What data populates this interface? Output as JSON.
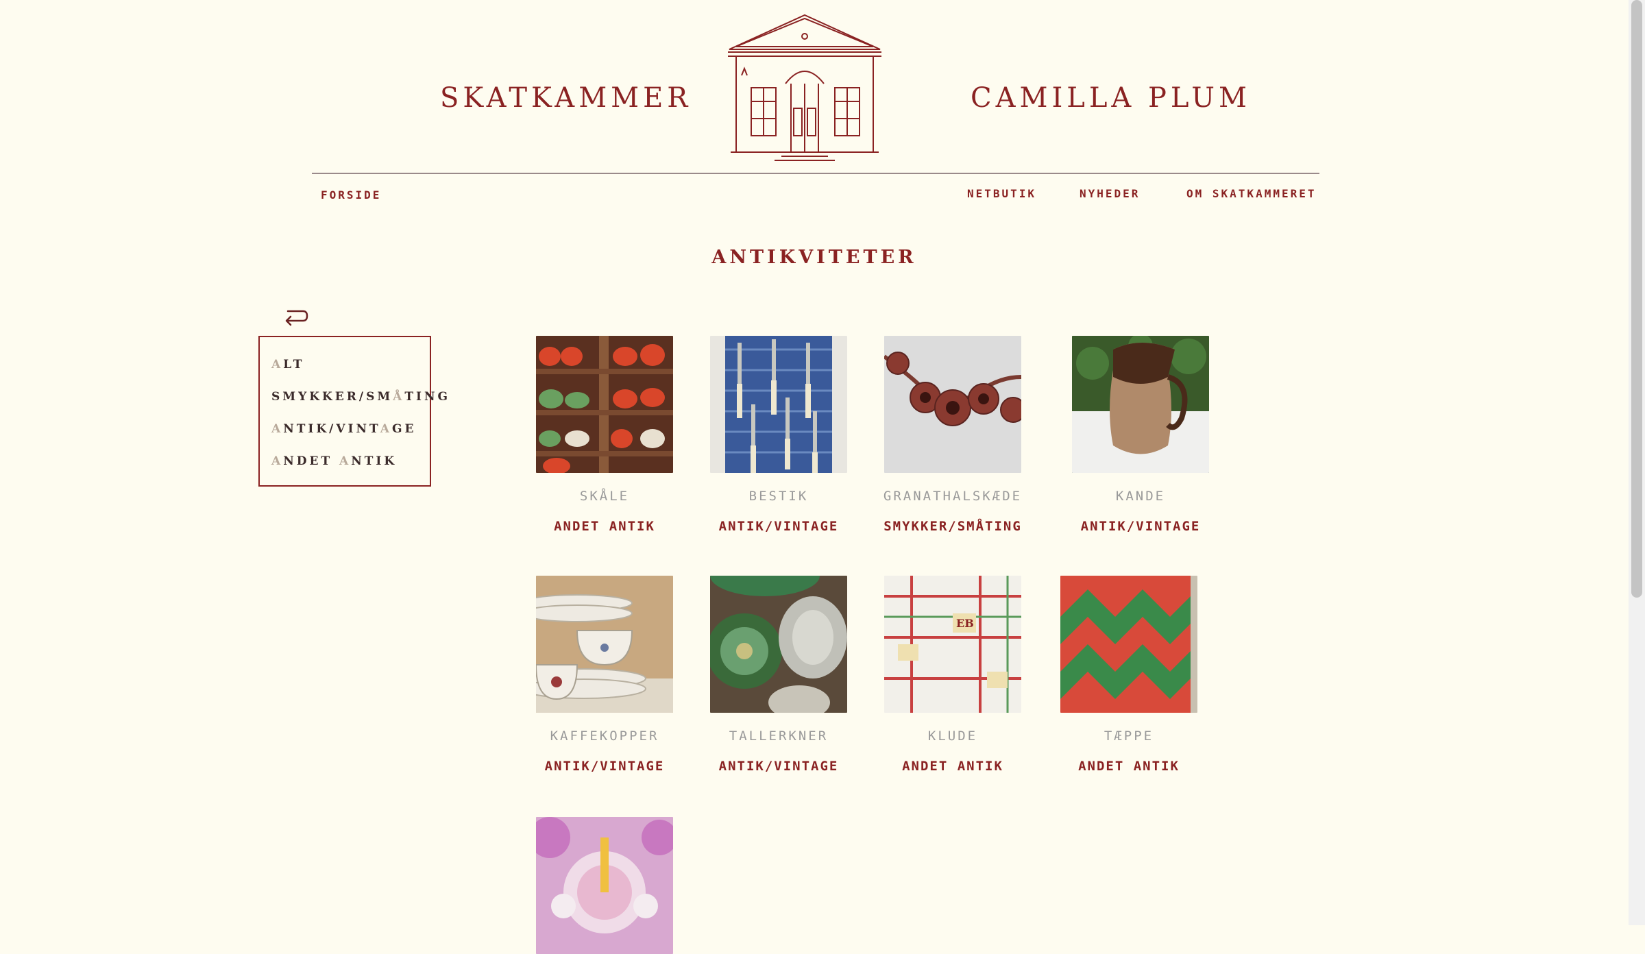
{
  "brand": {
    "left": "SKATKAMMER",
    "right": "CAMILLA PLUM"
  },
  "nav": {
    "forside": "FORSIDE",
    "netbutik": "NETBUTIK",
    "nyheder": "NYHEDER",
    "om": "OM SKATKAMMERET"
  },
  "page_title": "ANTIKVITETER",
  "filters": [
    {
      "first": "A",
      "mid": "LT",
      "second": "",
      "rest": ""
    },
    {
      "first": "",
      "mid": "SMYKKER/SM",
      "second": "Å",
      "rest": "TING"
    },
    {
      "first": "A",
      "mid": "NTIK/VINT",
      "second": "A",
      "rest": "GE"
    },
    {
      "first": "A",
      "mid": "NDET ",
      "second": "A",
      "rest": "NTIK"
    }
  ],
  "products": [
    {
      "name": "Skåle",
      "category": "Andet antik"
    },
    {
      "name": "Bestik",
      "category": "Antik/vintage"
    },
    {
      "name": "Granathalskæde",
      "category": "Smykker/småting"
    },
    {
      "name": "Kande",
      "category": "Antik/vintage"
    },
    {
      "name": "Kaffekopper",
      "category": "Antik/vintage"
    },
    {
      "name": "Tallerkner",
      "category": "Antik/vintage"
    },
    {
      "name": "Klude",
      "category": "Andet antik"
    },
    {
      "name": "Tæppe",
      "category": "Andet antik"
    },
    {
      "name": "",
      "category": ""
    }
  ],
  "colors": {
    "background": "#fefcf0",
    "accent": "#8a2222",
    "muted": "#999999"
  },
  "icons": {
    "back": "back-arrow-icon",
    "logo": "house-logo-icon"
  }
}
